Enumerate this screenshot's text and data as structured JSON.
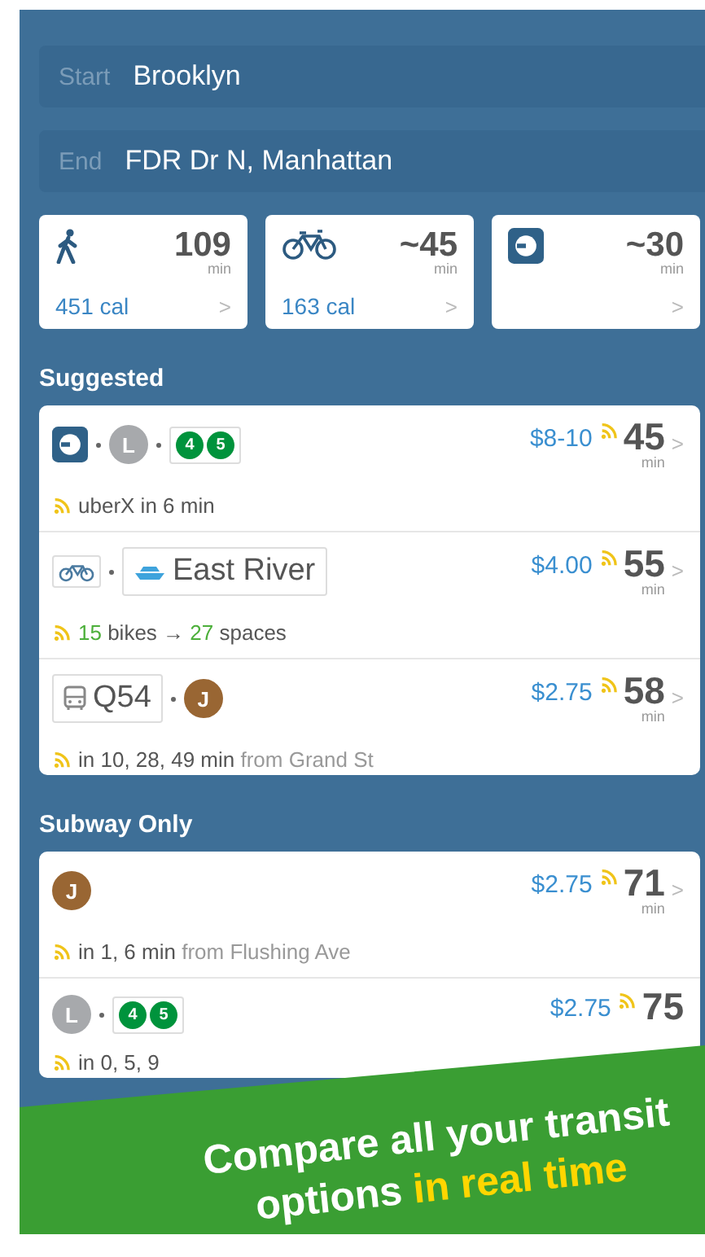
{
  "trip": {
    "start": {
      "label": "Start",
      "value": "Brooklyn"
    },
    "end": {
      "label": "End",
      "value": "FDR Dr N, Manhattan"
    }
  },
  "modes": [
    {
      "kind": "walk",
      "time": "109",
      "unit": "min",
      "calories": "451 cal",
      "chevron": ">"
    },
    {
      "kind": "bike",
      "time": "~45",
      "unit": "min",
      "calories": "163 cal",
      "chevron": ">"
    },
    {
      "kind": "ride",
      "time": "~30",
      "unit": "min",
      "chevron": ">"
    }
  ],
  "sections": [
    {
      "title": "Suggested",
      "routes": [
        {
          "legs": [
            {
              "kind": "ride"
            },
            {
              "kind": "line",
              "label": "L",
              "color": "#a7a9ac"
            },
            {
              "kind": "group",
              "lines": [
                {
                  "label": "4",
                  "color": "#00933c"
                },
                {
                  "label": "5",
                  "color": "#00933c"
                }
              ]
            }
          ],
          "price": "$8-10",
          "time": "45",
          "unit": "min",
          "chevron": ">",
          "detail": [
            {
              "kind": "plain",
              "text": "uberX in 6 min"
            }
          ]
        },
        {
          "legs": [
            {
              "kind": "bike"
            },
            {
              "kind": "ferry",
              "label": "East River"
            }
          ],
          "price": "$4.00",
          "time": "55",
          "unit": "min",
          "chevron": ">",
          "detail": [
            {
              "kind": "count",
              "text": "15"
            },
            {
              "kind": "plain",
              "text": " bikes → "
            },
            {
              "kind": "count",
              "text": "27"
            },
            {
              "kind": "plain",
              "text": " spaces"
            }
          ]
        },
        {
          "legs": [
            {
              "kind": "bus",
              "label": "Q54"
            },
            {
              "kind": "line",
              "label": "J",
              "color": "#996633"
            }
          ],
          "price": "$2.75",
          "time": "58",
          "unit": "min",
          "chevron": ">",
          "detail": [
            {
              "kind": "strong",
              "text": "in 10, 28, 49 min"
            },
            {
              "kind": "muted",
              "text": " from Grand St"
            }
          ]
        }
      ]
    },
    {
      "title": "Subway Only",
      "routes": [
        {
          "legs": [
            {
              "kind": "line",
              "label": "J",
              "color": "#996633"
            }
          ],
          "price": "$2.75",
          "time": "71",
          "unit": "min",
          "chevron": ">",
          "detail": [
            {
              "kind": "strong",
              "text": "in 1, 6 min"
            },
            {
              "kind": "muted",
              "text": " from Flushing Ave"
            }
          ]
        },
        {
          "legs": [
            {
              "kind": "line",
              "label": "L",
              "color": "#a7a9ac"
            },
            {
              "kind": "group",
              "lines": [
                {
                  "label": "4",
                  "color": "#00933c"
                },
                {
                  "label": "5",
                  "color": "#00933c"
                }
              ]
            }
          ],
          "price": "$2.75",
          "time": "75",
          "detail": [
            {
              "kind": "plain",
              "text": "in 0, 5, 9"
            }
          ]
        }
      ]
    }
  ],
  "banner": {
    "line_1": "Compare all your transit",
    "line_2": "options",
    "highlight": "in real time"
  }
}
